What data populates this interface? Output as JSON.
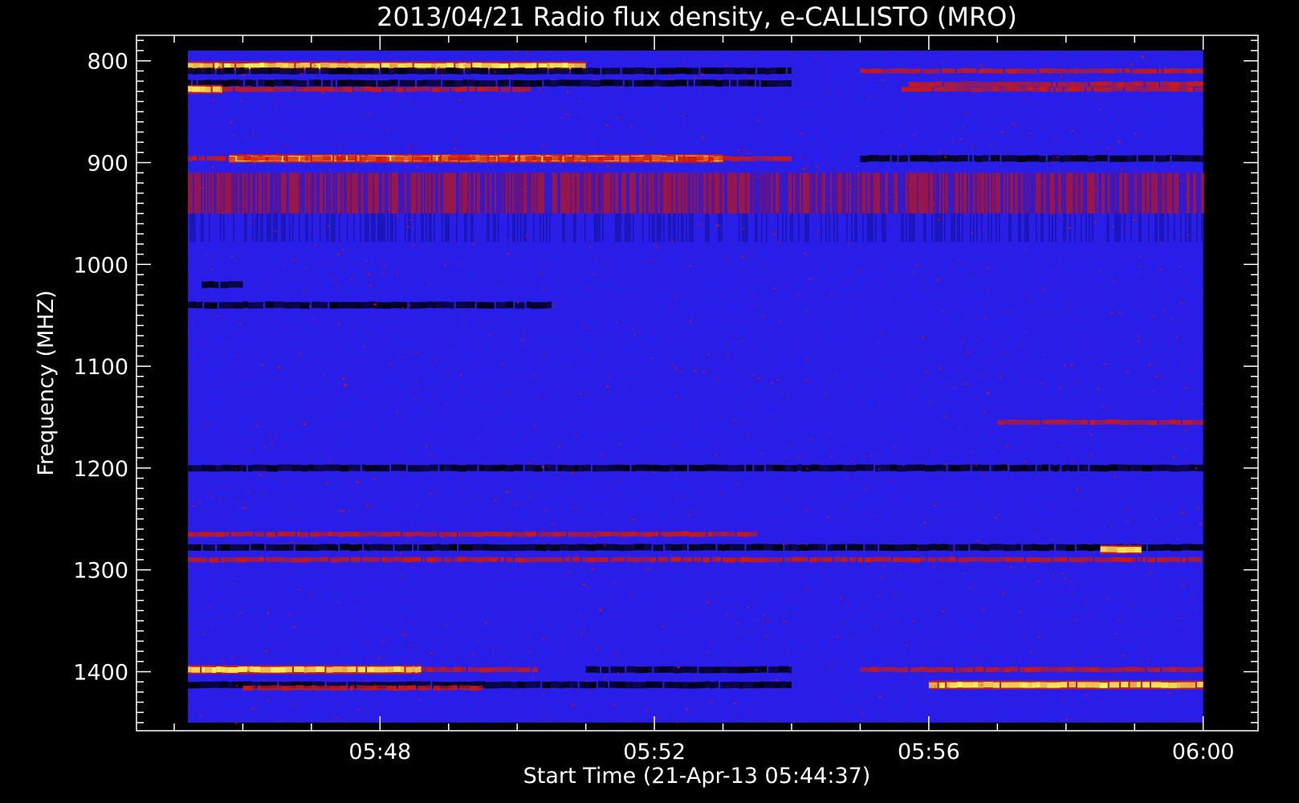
{
  "chart_data": {
    "type": "heatmap",
    "title": "2013/04/21  Radio flux density, e-CALLISTO (MRO)",
    "xlabel": "Start Time (21-Apr-13 05:44:37)",
    "ylabel": "Frequency (MHZ)",
    "x_tick_labels": [
      "05:48",
      "05:52",
      "05:56",
      "06:00"
    ],
    "x_tick_minutes": [
      48,
      52,
      56,
      60
    ],
    "x_start_minute": 44.617,
    "x_data_range_minutes": [
      45.2,
      60.0
    ],
    "x_axis_range_minutes": [
      44.45,
      60.8
    ],
    "y_tick_values": [
      800,
      900,
      1000,
      1100,
      1200,
      1300,
      1400
    ],
    "y_data_range": [
      790,
      1450
    ],
    "y_axis_range": [
      775,
      1458
    ],
    "y_inverted": true,
    "grid": false,
    "colors": {
      "background": "#000000",
      "base": "#2020f0",
      "emission": "#cc1a10",
      "strong": "#ffff60",
      "absorption": "#000010"
    },
    "bands": [
      {
        "freq": 805,
        "kind": "bright",
        "range_minutes": [
          45.2,
          51.0
        ]
      },
      {
        "freq": 810,
        "kind": "dark",
        "range_minutes": [
          45.2,
          54.0
        ]
      },
      {
        "freq": 810,
        "kind": "emission",
        "range_minutes": [
          55.0,
          60.0
        ]
      },
      {
        "freq": 822,
        "kind": "dark",
        "range_minutes": [
          45.2,
          54.0
        ]
      },
      {
        "freq": 823,
        "kind": "emission",
        "range_minutes": [
          55.7,
          60.0
        ]
      },
      {
        "freq": 828,
        "kind": "bright",
        "range_minutes": [
          45.2,
          45.7
        ]
      },
      {
        "freq": 828,
        "kind": "emission",
        "range_minutes": [
          45.7,
          50.2
        ]
      },
      {
        "freq": 828,
        "kind": "emission",
        "range_minutes": [
          55.6,
          60.0
        ]
      },
      {
        "freq": 896,
        "kind": "bright",
        "range_minutes": [
          45.8,
          53.0
        ]
      },
      {
        "freq": 896,
        "kind": "emission",
        "range_minutes": [
          45.2,
          54.0
        ]
      },
      {
        "freq": 896,
        "kind": "dark",
        "range_minutes": [
          55.0,
          60.0
        ]
      },
      {
        "freq": 1020,
        "kind": "dark",
        "range_minutes": [
          45.4,
          46.0
        ]
      },
      {
        "freq": 1040,
        "kind": "dark",
        "range_minutes": [
          45.2,
          50.5
        ]
      },
      {
        "freq": 1155,
        "kind": "emission",
        "range_minutes": [
          57.0,
          60.0
        ]
      },
      {
        "freq": 1200,
        "kind": "dark",
        "range_minutes": [
          45.2,
          60.0
        ]
      },
      {
        "freq": 1265,
        "kind": "emission",
        "range_minutes": [
          45.2,
          53.5
        ]
      },
      {
        "freq": 1278,
        "kind": "dark",
        "range_minutes": [
          45.2,
          60.0
        ]
      },
      {
        "freq": 1280,
        "kind": "bright",
        "range_minutes": [
          58.5,
          59.1
        ]
      },
      {
        "freq": 1290,
        "kind": "emission",
        "range_minutes": [
          45.2,
          60.0
        ]
      },
      {
        "freq": 1398,
        "kind": "bright",
        "range_minutes": [
          45.2,
          48.6
        ]
      },
      {
        "freq": 1398,
        "kind": "emission",
        "range_minutes": [
          48.6,
          50.3
        ]
      },
      {
        "freq": 1398,
        "kind": "emission",
        "range_minutes": [
          55.0,
          60.0
        ]
      },
      {
        "freq": 1398,
        "kind": "dark",
        "range_minutes": [
          51.0,
          54.0
        ]
      },
      {
        "freq": 1413,
        "kind": "dark",
        "range_minutes": [
          45.2,
          54.0
        ]
      },
      {
        "freq": 1413,
        "kind": "bright",
        "range_minutes": [
          56.0,
          60.0
        ]
      },
      {
        "freq": 1416,
        "kind": "emission",
        "range_minutes": [
          46.0,
          49.5
        ]
      }
    ],
    "stripe_zone": {
      "freq_range": [
        910,
        978
      ],
      "range_minutes": [
        45.2,
        60.0
      ]
    }
  }
}
